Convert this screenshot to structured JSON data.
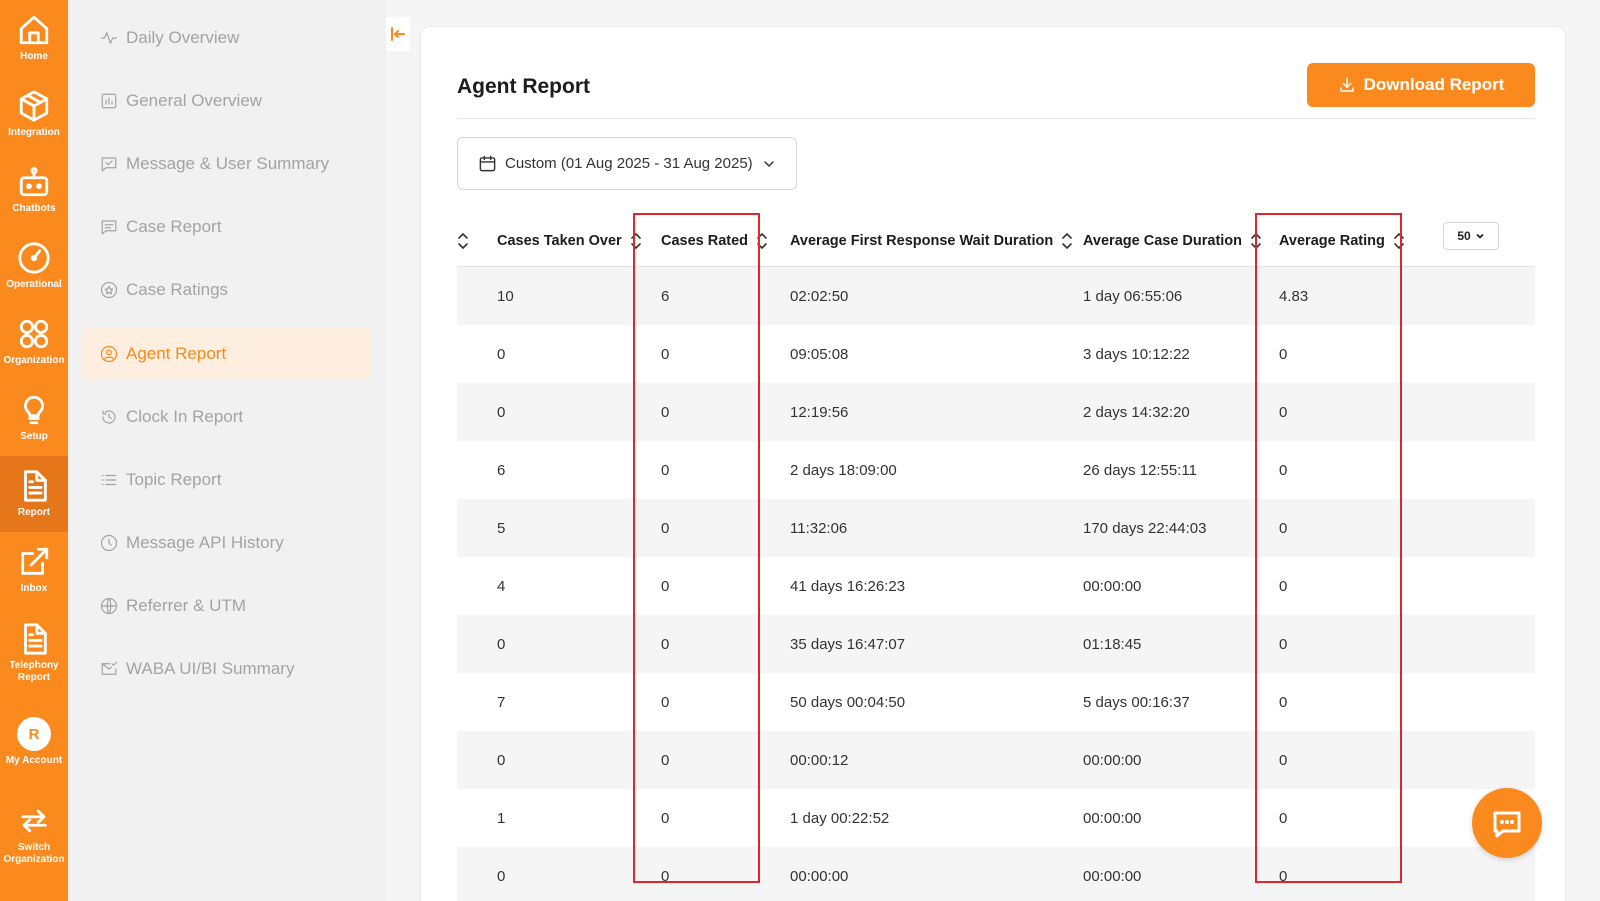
{
  "rail": {
    "items": [
      {
        "label": "Home",
        "icon": "home-icon"
      },
      {
        "label": "Integration",
        "icon": "cube-icon"
      },
      {
        "label": "Chatbots",
        "icon": "robot-icon"
      },
      {
        "label": "Operational",
        "icon": "gauge-icon"
      },
      {
        "label": "Organization",
        "icon": "grid-circles-icon"
      },
      {
        "label": "Setup",
        "icon": "lightbulb-icon"
      },
      {
        "label": "Report",
        "icon": "document-icon",
        "active": true
      },
      {
        "label": "Inbox",
        "icon": "external-link-icon"
      },
      {
        "label": "Telephony Report",
        "label_line1": "Telephony",
        "label_line2": "Report",
        "icon": "document-icon"
      },
      {
        "label": "My Account",
        "avatar_initial": "R"
      },
      {
        "label": "Switch Organization",
        "label_line1": "Switch",
        "label_line2": "Organization",
        "icon": "switch-icon"
      }
    ]
  },
  "subnav": {
    "items": [
      {
        "label": "Daily Overview",
        "icon": "pulse-icon"
      },
      {
        "label": "General Overview",
        "icon": "bar-chart-icon"
      },
      {
        "label": "Message & User Summary",
        "icon": "message-check-icon"
      },
      {
        "label": "Case Report",
        "icon": "message-lines-icon"
      },
      {
        "label": "Case Ratings",
        "icon": "star-circle-icon"
      },
      {
        "label": "Agent Report",
        "icon": "user-circle-icon",
        "active": true
      },
      {
        "label": "Clock In Report",
        "icon": "clock-in-icon"
      },
      {
        "label": "Topic Report",
        "icon": "list-icon"
      },
      {
        "label": "Message API History",
        "icon": "history-icon"
      },
      {
        "label": "Referrer & UTM",
        "icon": "globe-icon"
      },
      {
        "label": "WABA UI/BI Summary",
        "icon": "mail-check-icon"
      }
    ]
  },
  "main": {
    "title": "Agent Report",
    "download_label": "Download Report",
    "date_filter": "Custom (01 Aug 2025 - 31 Aug 2025)",
    "page_size": "50"
  },
  "table": {
    "headers": [
      "Cases Taken Over",
      "Cases Rated",
      "Average First Response Wait Duration",
      "Average Case Duration",
      "Average Rating"
    ],
    "rows": [
      [
        "10",
        "6",
        "02:02:50",
        "1 day 06:55:06",
        "4.83"
      ],
      [
        "0",
        "0",
        "09:05:08",
        "3 days 10:12:22",
        "0"
      ],
      [
        "0",
        "0",
        "12:19:56",
        "2 days 14:32:20",
        "0"
      ],
      [
        "6",
        "0",
        "2 days 18:09:00",
        "26 days 12:55:11",
        "0"
      ],
      [
        "5",
        "0",
        "11:32:06",
        "170 days 22:44:03",
        "0"
      ],
      [
        "4",
        "0",
        "41 days 16:26:23",
        "00:00:00",
        "0"
      ],
      [
        "0",
        "0",
        "35 days 16:47:07",
        "01:18:45",
        "0"
      ],
      [
        "7",
        "0",
        "50 days 00:04:50",
        "5 days 00:16:37",
        "0"
      ],
      [
        "0",
        "0",
        "00:00:12",
        "00:00:00",
        "0"
      ],
      [
        "1",
        "0",
        "1 day 00:22:52",
        "00:00:00",
        "0"
      ],
      [
        "0",
        "0",
        "00:00:00",
        "00:00:00",
        "0"
      ]
    ]
  },
  "colors": {
    "brand": "#fb8a1e",
    "brand_active": "#e6761a",
    "nav_active_bg": "#fdeee0",
    "highlight_border": "#e0252e"
  }
}
